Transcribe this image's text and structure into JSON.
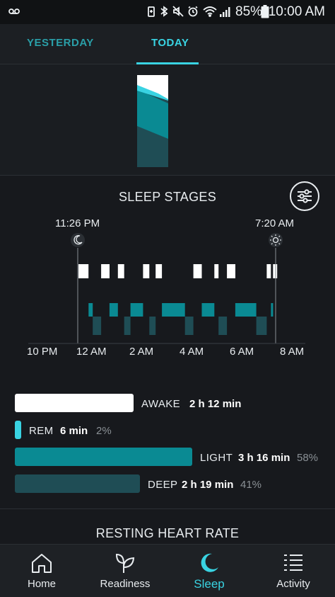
{
  "status_bar": {
    "battery_percent": "85%",
    "time": "10:00 AM"
  },
  "tabs": [
    {
      "label": "YESTERDAY",
      "active": false
    },
    {
      "label": "TODAY",
      "active": true
    }
  ],
  "sleep_stages": {
    "title": "SLEEP STAGES",
    "bedtime": "11:26 PM",
    "wake_time": "7:20 AM",
    "x_ticks": [
      "10 PM",
      "12 AM",
      "2 AM",
      "4 AM",
      "6 AM",
      "8 AM"
    ]
  },
  "chart_data": {
    "type": "bar",
    "title": "SLEEP STAGES",
    "x_ticks": [
      "10 PM",
      "12 AM",
      "2 AM",
      "4 AM",
      "6 AM",
      "8 AM"
    ],
    "x_range": [
      "10 PM",
      "8 AM"
    ],
    "bedtime": "11:26 PM",
    "wake_time": "7:20 AM",
    "stage_levels": [
      "awake",
      "rem",
      "light",
      "deep"
    ],
    "hypnogram": [
      {
        "start": "23:26",
        "end": "23:50",
        "stage": "awake"
      },
      {
        "start": "23:50",
        "end": "00:00",
        "stage": "light"
      },
      {
        "start": "00:00",
        "end": "00:20",
        "stage": "deep"
      },
      {
        "start": "00:20",
        "end": "00:40",
        "stage": "awake"
      },
      {
        "start": "00:40",
        "end": "01:00",
        "stage": "light"
      },
      {
        "start": "01:00",
        "end": "01:15",
        "stage": "awake"
      },
      {
        "start": "01:15",
        "end": "01:30",
        "stage": "deep"
      },
      {
        "start": "01:30",
        "end": "02:00",
        "stage": "light"
      },
      {
        "start": "02:00",
        "end": "02:15",
        "stage": "awake"
      },
      {
        "start": "02:15",
        "end": "02:30",
        "stage": "deep"
      },
      {
        "start": "02:30",
        "end": "02:45",
        "stage": "awake"
      },
      {
        "start": "02:45",
        "end": "03:40",
        "stage": "light"
      },
      {
        "start": "03:40",
        "end": "04:00",
        "stage": "deep"
      },
      {
        "start": "04:00",
        "end": "04:20",
        "stage": "awake"
      },
      {
        "start": "04:20",
        "end": "04:50",
        "stage": "light"
      },
      {
        "start": "04:50",
        "end": "05:00",
        "stage": "awake"
      },
      {
        "start": "05:00",
        "end": "05:20",
        "stage": "deep"
      },
      {
        "start": "05:20",
        "end": "05:40",
        "stage": "awake"
      },
      {
        "start": "05:40",
        "end": "06:30",
        "stage": "light"
      },
      {
        "start": "06:30",
        "end": "06:55",
        "stage": "deep"
      },
      {
        "start": "06:55",
        "end": "07:05",
        "stage": "awake"
      },
      {
        "start": "07:05",
        "end": "07:10",
        "stage": "light"
      },
      {
        "start": "07:10",
        "end": "07:20",
        "stage": "awake"
      }
    ],
    "summary": [
      {
        "stage": "AWAKE",
        "duration": "2 h 12 min",
        "percent": null,
        "color": "#ffffff",
        "fraction_of_max": 0.67
      },
      {
        "stage": "REM",
        "duration": "6 min",
        "percent": "2%",
        "color": "#39d3e2",
        "fraction_of_max": 0.03
      },
      {
        "stage": "LIGHT",
        "duration": "3 h 16 min",
        "percent": "58%",
        "color": "#0a8a93",
        "fraction_of_max": 1.0
      },
      {
        "stage": "DEEP",
        "duration": "2 h 19 min",
        "percent": "41%",
        "color": "#1f4d55",
        "fraction_of_max": 0.71
      }
    ]
  },
  "legend": {
    "awake": {
      "name": "AWAKE",
      "duration": "2 h 12 min"
    },
    "rem": {
      "name": "REM",
      "duration": "6 min",
      "percent": "2%"
    },
    "light": {
      "name": "LIGHT",
      "duration": "3 h 16 min",
      "percent": "58%"
    },
    "deep": {
      "name": "DEEP",
      "duration": "2 h 19 min",
      "percent": "41%"
    }
  },
  "next_section": {
    "title": "RESTING HEART RATE"
  },
  "bottom_nav": [
    {
      "label": "Home",
      "icon": "home-icon",
      "active": false
    },
    {
      "label": "Readiness",
      "icon": "sprout-icon",
      "active": false
    },
    {
      "label": "Sleep",
      "icon": "moon-icon",
      "active": true
    },
    {
      "label": "Activity",
      "icon": "activity-list-icon",
      "active": false
    }
  ],
  "colors": {
    "accent": "#39d3e2",
    "light_sleep": "#0a8a93",
    "deep_sleep": "#1f4d55",
    "awake": "#ffffff",
    "background": "#17191d"
  }
}
